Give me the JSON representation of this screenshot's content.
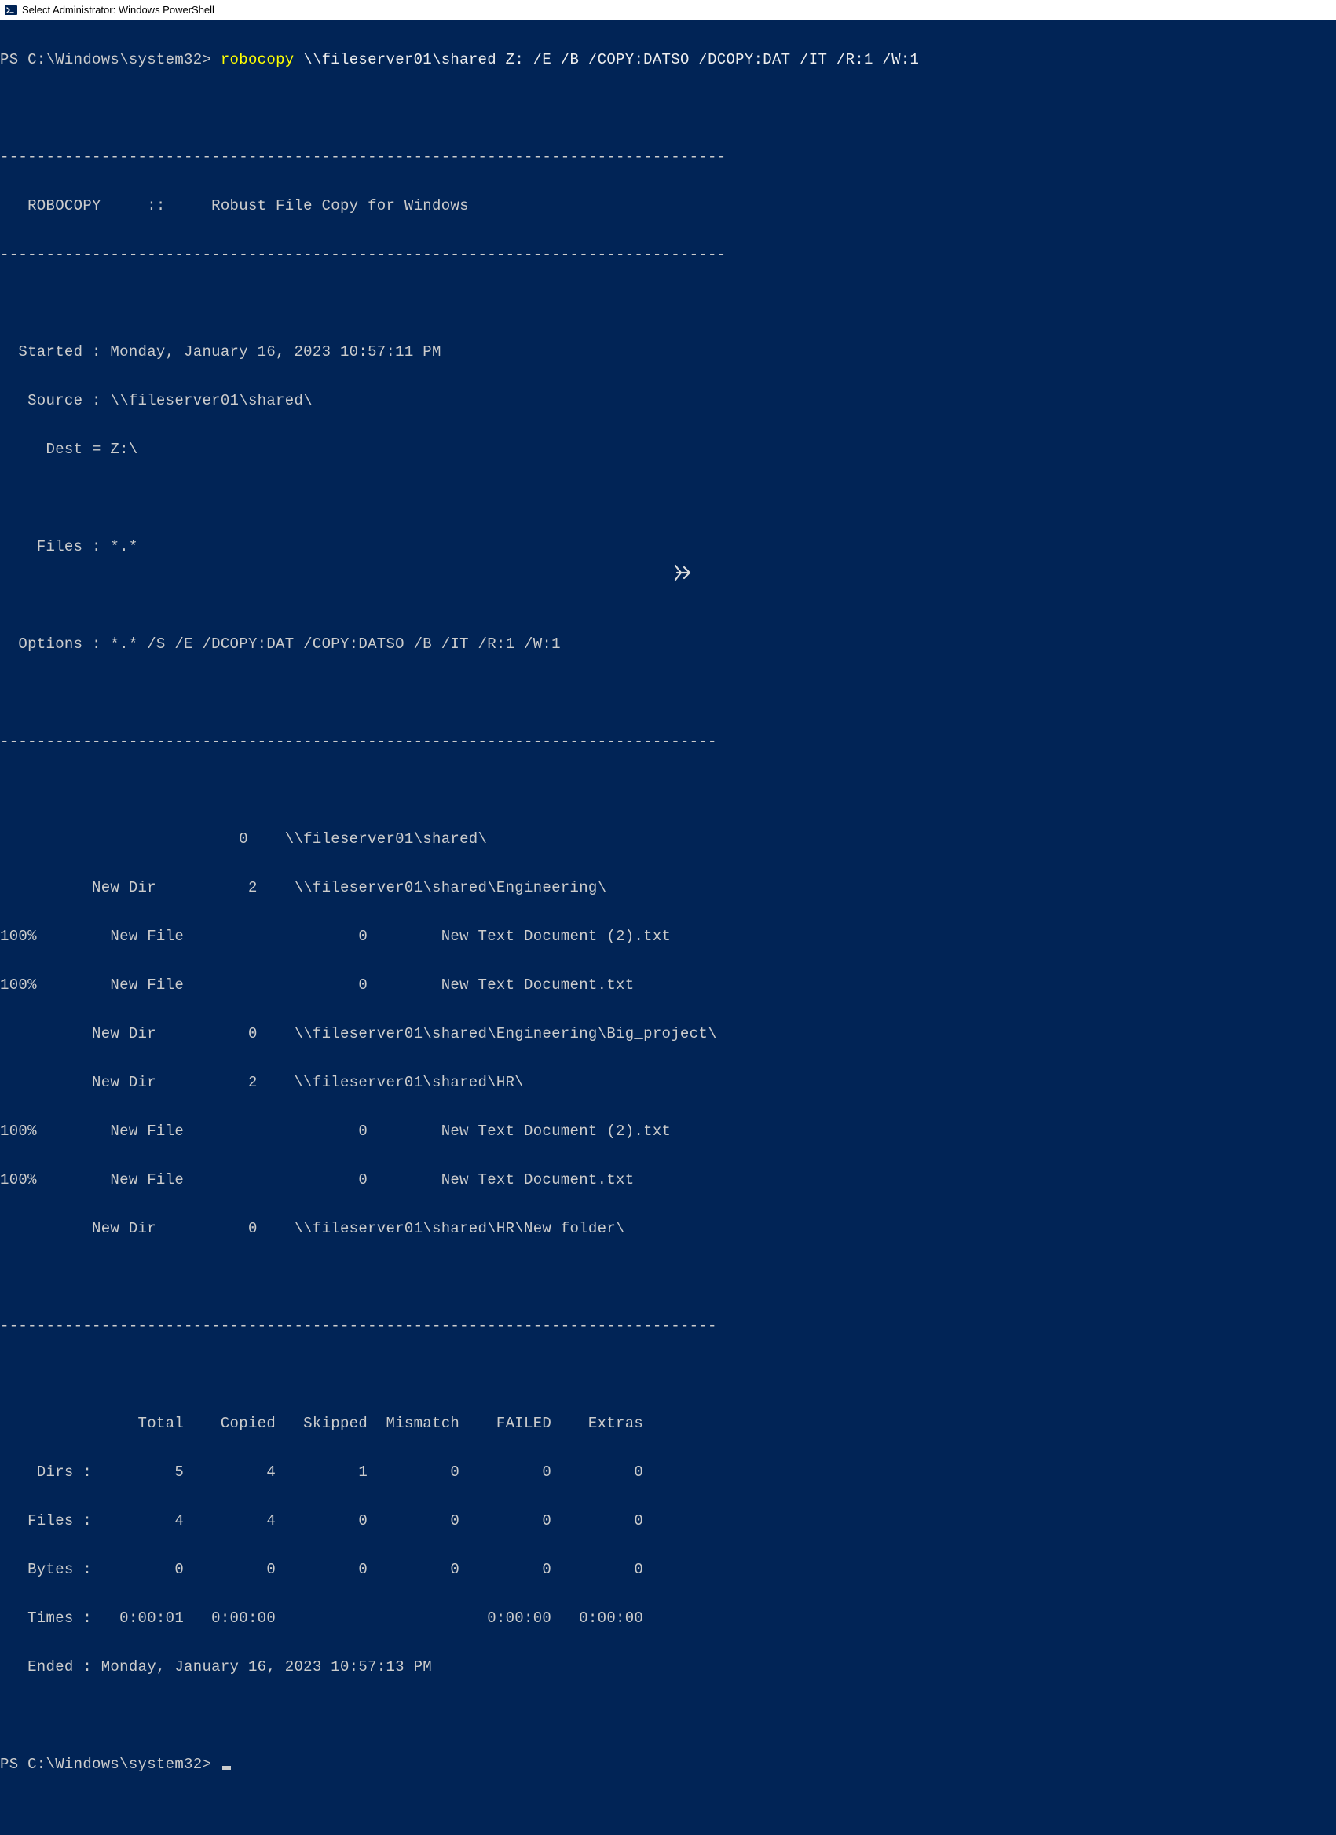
{
  "window": {
    "title": "Select Administrator: Windows PowerShell"
  },
  "prompt1": {
    "prefix": "PS C:\\Windows\\system32> ",
    "cmd": "robocopy",
    "args": " \\\\fileserver01\\shared Z: /E /B /COPY:DATSO /DCOPY:DAT /IT /R:1 /W:1"
  },
  "banner": {
    "sep": "-------------------------------------------------------------------------------",
    "title": "   ROBOCOPY     ::     Robust File Copy for Windows                              "
  },
  "info": {
    "started": "  Started : Monday, January 16, 2023 10:57:11 PM",
    "source": "   Source : \\\\fileserver01\\shared\\",
    "dest": "     Dest = Z:\\",
    "blank1": "",
    "files": "    Files : *.*",
    "blank2": "",
    "options": "  Options : *.* /S /E /DCOPY:DAT /COPY:DATSO /B /IT /R:1 /W:1 "
  },
  "sep2": "------------------------------------------------------------------------------",
  "progress": {
    "l0": "                          0    \\\\fileserver01\\shared\\",
    "l1": "          New Dir          2    \\\\fileserver01\\shared\\Engineering\\",
    "l2": "100%        New File                   0        New Text Document (2).txt",
    "l2b": "100%        New File                   0        New Text Document.txt",
    "l3": "          New Dir          0    \\\\fileserver01\\shared\\Engineering\\Big_project\\",
    "l4": "          New Dir          2    \\\\fileserver01\\shared\\HR\\",
    "l5": "100%        New File                   0        New Text Document (2).txt",
    "l6": "100%        New File                   0        New Text Document.txt",
    "l7": "          New Dir          0    \\\\fileserver01\\shared\\HR\\New folder\\"
  },
  "sep3": "------------------------------------------------------------------------------",
  "summary": {
    "hdr": "               Total    Copied   Skipped  Mismatch    FAILED    Extras",
    "dirs": "    Dirs :         5         4         1         0         0         0",
    "files": "   Files :         4         4         0         0         0         0",
    "bytes": "   Bytes :         0         0         0         0         0         0",
    "times": "   Times :   0:00:01   0:00:00                       0:00:00   0:00:00",
    "ended": "   Ended : Monday, January 16, 2023 10:57:13 PM"
  },
  "prompt2": {
    "prefix": "PS C:\\Windows\\system32> "
  }
}
